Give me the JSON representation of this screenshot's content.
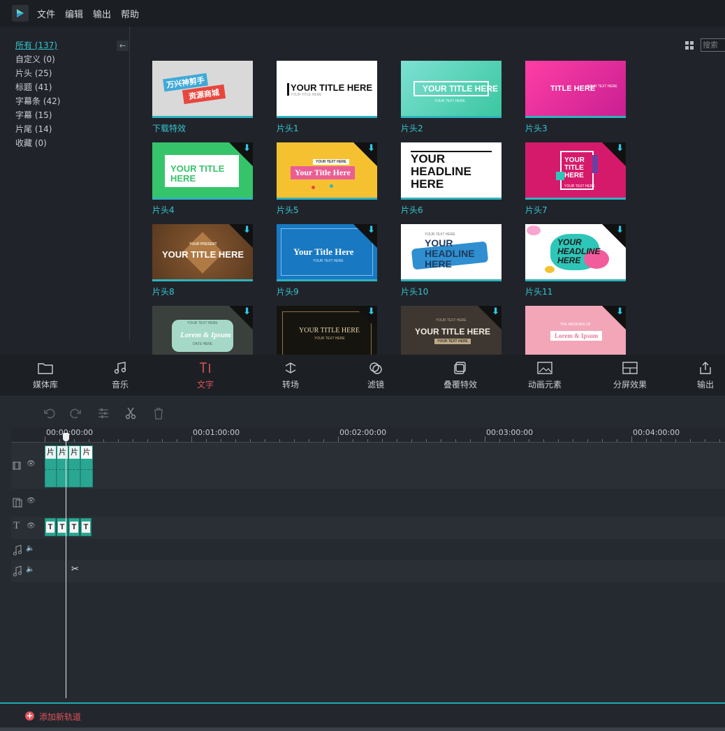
{
  "menu": {
    "items": [
      "文件",
      "编辑",
      "输出",
      "帮助"
    ]
  },
  "categories": [
    {
      "label": "所有 (137)",
      "active": true
    },
    {
      "label": "自定义 (0)"
    },
    {
      "label": "片头 (25)"
    },
    {
      "label": "标题 (41)"
    },
    {
      "label": "字幕条 (42)"
    },
    {
      "label": "字幕 (15)"
    },
    {
      "label": "片尾 (14)"
    },
    {
      "label": "收藏 (0)"
    }
  ],
  "collapse_label": "←",
  "search": {
    "placeholder": "搜索"
  },
  "tiles": [
    {
      "label": "下载特效",
      "text": [
        "万兴神剪手",
        "资源商城"
      ]
    },
    {
      "label": "片头1",
      "text": [
        "YOUR TITLE HERE",
        "YOUR TITLE HERE"
      ]
    },
    {
      "label": "片头2",
      "text": [
        "YOUR TITLE HERE",
        "YOUR TEXT HERE"
      ]
    },
    {
      "label": "片头3",
      "text": [
        "TITLE HERE",
        "YOUR TEXT HERE"
      ]
    },
    {
      "label": "片头4",
      "text": [
        "YOUR TITLE",
        "HERE"
      ]
    },
    {
      "label": "片头5",
      "text": [
        "YOUR TEXT HERE",
        "Your Title Here"
      ]
    },
    {
      "label": "片头6",
      "text": [
        "YOUR",
        "HEADLINE",
        "HERE"
      ]
    },
    {
      "label": "片头7",
      "text": [
        "YOUR",
        "TITLE",
        "HERE",
        "YOUR TEXT HERE"
      ]
    },
    {
      "label": "片头8",
      "text": [
        "YOUR PRESENT",
        "YOUR TITLE HERE"
      ]
    },
    {
      "label": "片头9",
      "text": [
        "Your Title Here",
        "YOUR TEXT HERE"
      ]
    },
    {
      "label": "片头10",
      "text": [
        "YOUR TEXT HERE",
        "YOUR",
        "HEADLINE",
        "HERE"
      ]
    },
    {
      "label": "片头11",
      "text": [
        "YOUR",
        "HEADLINE",
        "HERE"
      ]
    },
    {
      "label": "",
      "text": [
        "YOUR TEXT HERE",
        "Lorem & Ipsum",
        "DATE HERE"
      ]
    },
    {
      "label": "",
      "text": [
        "YOUR TITLE HERE",
        "YOUR TEXT HERE"
      ]
    },
    {
      "label": "",
      "text": [
        "YOUR TEXT HERE",
        "YOUR TITLE HERE",
        "YOUR TEXT HERE"
      ]
    },
    {
      "label": "",
      "text": [
        "THE WEDDING OF",
        "Lorem & Ipsum"
      ]
    }
  ],
  "toolbar": {
    "media": "媒体库",
    "music": "音乐",
    "text": "文字",
    "transition": "转场",
    "filter": "滤镜",
    "overlay": "叠覆特效",
    "elements": "动画元素",
    "split": "分屏效果",
    "export": "输出"
  },
  "timecodes": [
    "00:00:00:00",
    "00:01:00:00",
    "00:02:00:00",
    "00:03:00:00",
    "00:04:00:00"
  ],
  "video_clip_caption": "片",
  "text_clip_caption": "T",
  "add_track": "添加新轨道"
}
